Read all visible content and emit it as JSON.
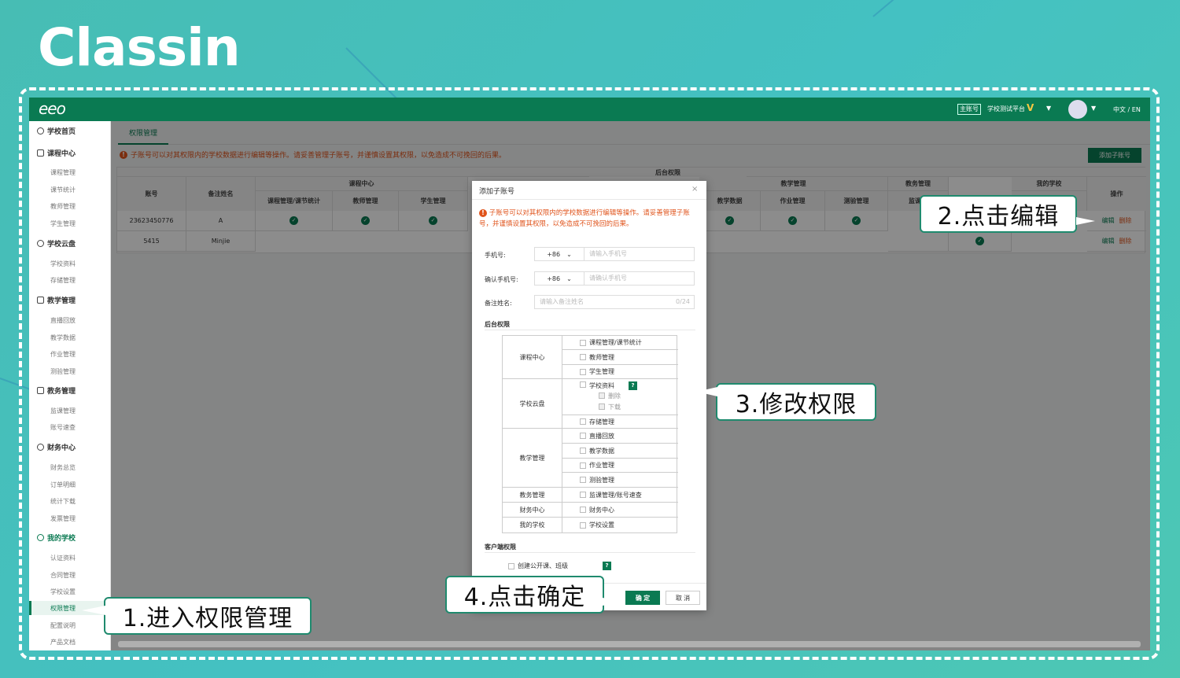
{
  "brand": "Classin",
  "topbar": {
    "logo": "eeo",
    "account_badge": "主账号",
    "school_name": "学校测试平台",
    "vip_badge": "V",
    "language": "中文 / EN"
  },
  "sidebar": {
    "sections": [
      {
        "label": "学校首页",
        "items": []
      },
      {
        "label": "课程中心",
        "items": [
          "课程管理",
          "课节统计",
          "教师管理",
          "学生管理"
        ]
      },
      {
        "label": "学校云盘",
        "items": [
          "学校资料",
          "存储管理"
        ]
      },
      {
        "label": "教学管理",
        "items": [
          "直播回放",
          "教学数据",
          "作业管理",
          "测验管理"
        ]
      },
      {
        "label": "教务管理",
        "items": [
          "监课管理",
          "账号速查"
        ]
      },
      {
        "label": "财务中心",
        "items": [
          "财务总览",
          "订单明细",
          "统计下载",
          "发票管理"
        ]
      },
      {
        "label": "我的学校",
        "items": [
          "认证资料",
          "合同管理",
          "学校设置",
          "权限管理",
          "配置说明",
          "产品文档"
        ]
      }
    ]
  },
  "page": {
    "tab": "权限管理",
    "warning": "子账号可以对其权限内的学校数据进行编辑等操作。请妥善管理子账号，并谨慎设置其权限，以免造成不可挽回的后果。",
    "add_button": "添加子账号"
  },
  "table": {
    "group_header": "后台权限",
    "col_account": "账号",
    "col_name": "备注姓名",
    "col_ops": "操作",
    "groups": [
      "课程中心",
      "教学管理",
      "教务管理",
      "我的学校"
    ],
    "subcols": [
      "课程管理/课节统计",
      "教师管理",
      "学生管理",
      "教学数据",
      "作业管理",
      "测验管理",
      "监课管",
      "学校设置"
    ],
    "rows": [
      {
        "account": "23623450776",
        "name": "A",
        "edit": "编辑",
        "delete": "删除"
      },
      {
        "account": "5415",
        "name": "Minjie",
        "edit": "编辑",
        "delete": "删除"
      }
    ]
  },
  "dialog": {
    "title": "添加子账号",
    "close": "×",
    "warning": "子账号可以对其权限内的学校数据进行编辑等操作。请妥善管理子账号，并谨慎设置其权限，以免造成不可挽回的后果。",
    "phone_label": "手机号:",
    "phone_code": "+86",
    "phone_placeholder": "请输入手机号",
    "confirm_phone_label": "确认手机号:",
    "confirm_phone_code": "+86",
    "confirm_phone_placeholder": "请确认手机号",
    "name_label": "备注姓名:",
    "name_placeholder": "请输入备注姓名",
    "name_count": "0/24",
    "backend_title": "后台权限",
    "perm_cats": [
      "课程中心",
      "学校云盘",
      "教学管理",
      "教务管理",
      "财务中心",
      "我的学校"
    ],
    "perms": [
      "课程管理/课节统计",
      "教师管理",
      "学生管理",
      "学校资料",
      "存储管理",
      "直播回放",
      "教学数据",
      "作业管理",
      "测验管理",
      "监课管理/账号速查",
      "财务中心",
      "学校设置"
    ],
    "sub_perms": [
      "删除",
      "下载"
    ],
    "client_title": "客户端权限",
    "client_perm": "创建公开课、班级",
    "help": "?",
    "confirm": "确 定",
    "cancel": "取 消"
  },
  "callouts": {
    "step1": "1.进入权限管理",
    "step2": "2.点击编辑",
    "step3": "3.修改权限",
    "step4": "4.点击确定"
  },
  "colors": {
    "primary": "#0a7a52",
    "warning": "#e0541c",
    "bg": "#47bdb4"
  }
}
